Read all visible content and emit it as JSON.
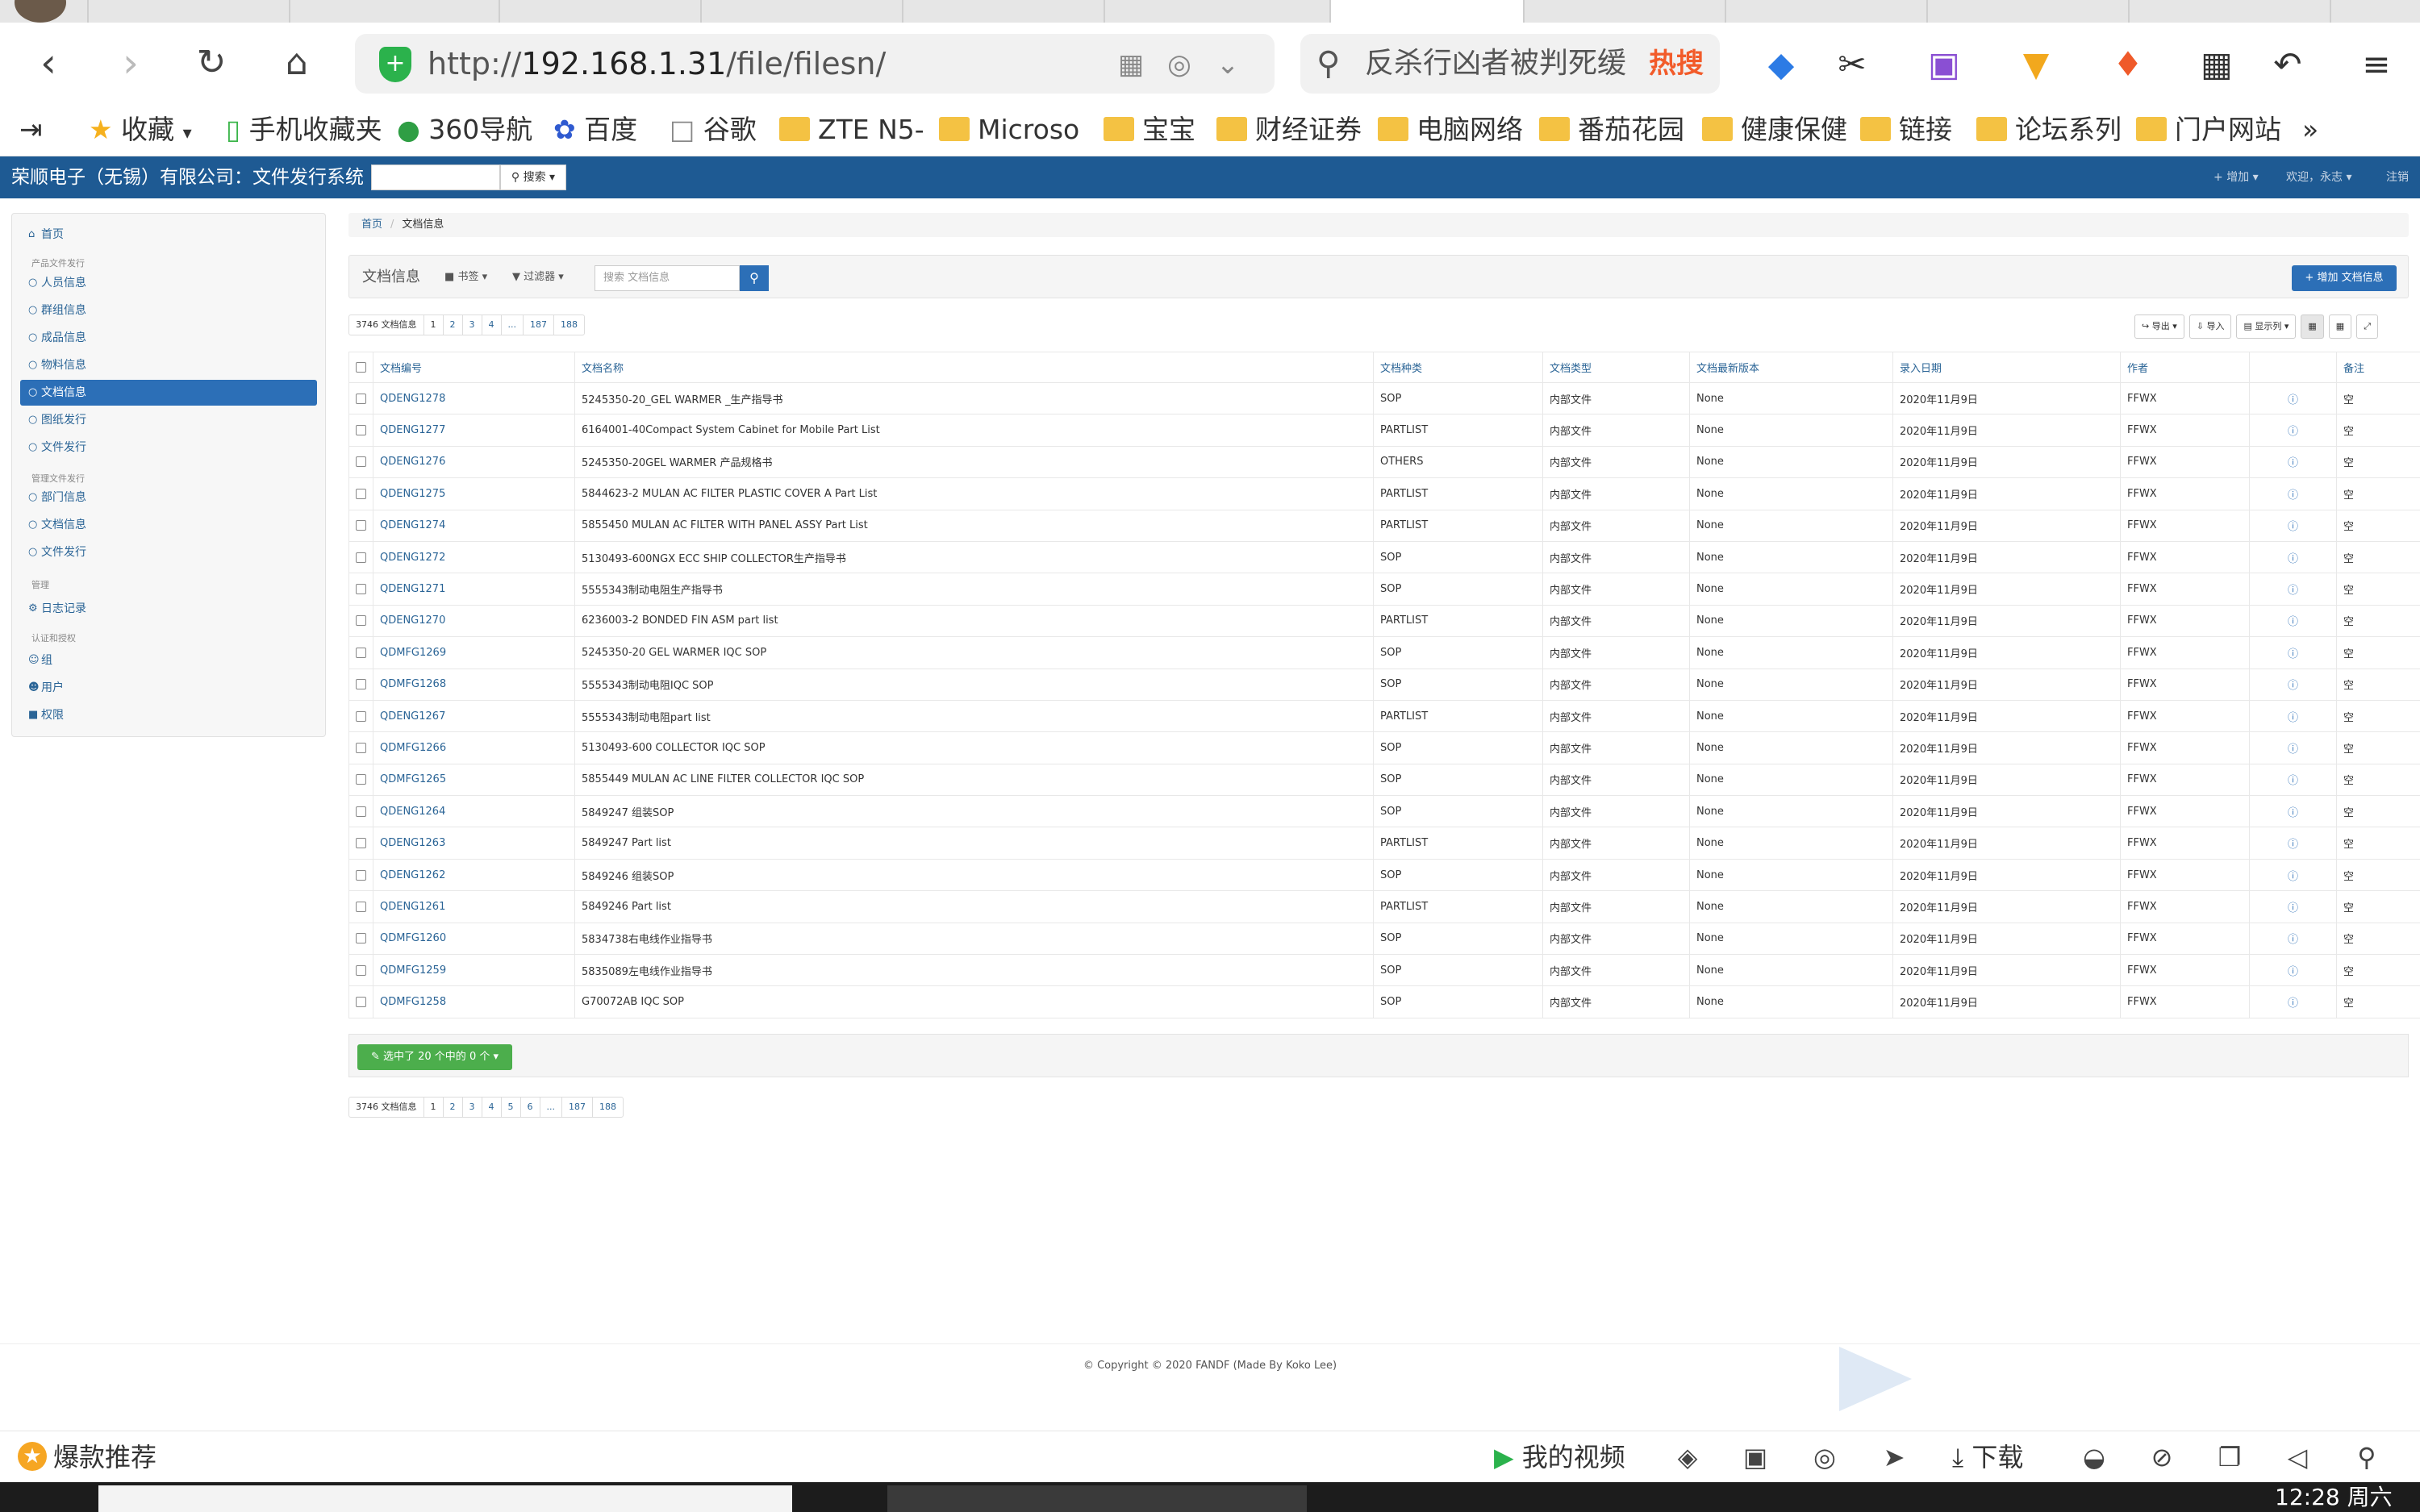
{
  "browser": {
    "url_prefix": "http://",
    "url_host": "192.168.1.31",
    "url_path": "/file/filesn/",
    "search_text": "反杀行凶者被判死缓",
    "search_hot": "热搜",
    "bookmarks": [
      {
        "label": "收藏",
        "icon": "star-icon"
      },
      {
        "label": "手机收藏夹",
        "icon": "phone-icon"
      },
      {
        "label": "360导航",
        "icon": "360-icon"
      },
      {
        "label": "百度",
        "icon": "paw-icon"
      },
      {
        "label": "谷歌",
        "icon": "page-icon"
      },
      {
        "label": "ZTE N5-",
        "icon": "folder-icon"
      },
      {
        "label": "Microso",
        "icon": "folder-icon"
      },
      {
        "label": "宝宝",
        "icon": "folder-icon"
      },
      {
        "label": "财经证券",
        "icon": "folder-icon"
      },
      {
        "label": "电脑网络",
        "icon": "folder-icon"
      },
      {
        "label": "番茄花园",
        "icon": "folder-icon"
      },
      {
        "label": "健康保健",
        "icon": "folder-icon"
      },
      {
        "label": "链接",
        "icon": "folder-icon"
      },
      {
        "label": "论坛系列",
        "icon": "folder-icon"
      },
      {
        "label": "门户网站",
        "icon": "folder-icon"
      }
    ],
    "more": "»"
  },
  "app": {
    "brand": "荣顺电子（无锡）有限公司：文件发行系统",
    "search_button": "搜索",
    "add_menu": "增加",
    "welcome": "欢迎，永志",
    "logout": "注销"
  },
  "sidebar": {
    "home": "首页",
    "group1": "产品文件发行",
    "g1_items": [
      "人员信息",
      "群组信息",
      "成品信息",
      "物料信息",
      "文档信息",
      "图纸发行",
      "文件发行"
    ],
    "group2": "管理文件发行",
    "g2_items": [
      "部门信息",
      "文档信息",
      "文件发行"
    ],
    "group3": "管理",
    "log": "日志记录",
    "group4": "认证和授权",
    "auth_items": [
      "组",
      "用户",
      "权限"
    ]
  },
  "breadcrumb": {
    "home": "首页",
    "current": "文档信息"
  },
  "panel": {
    "title": "文档信息",
    "bookmarks_dd": "书签",
    "filter_dd": "过滤器",
    "search_placeholder": "搜索 文档信息",
    "add_button": "增加 文档信息"
  },
  "pager_top": {
    "count": "3746 文档信息",
    "pages": [
      "1",
      "2",
      "3",
      "4",
      "...",
      "187",
      "188"
    ]
  },
  "pager_bottom": {
    "count": "3746 文档信息",
    "pages": [
      "1",
      "2",
      "3",
      "4",
      "5",
      "6",
      "...",
      "187",
      "188"
    ]
  },
  "table_tools": {
    "export": "导出",
    "import": "导入",
    "columns": "显示列"
  },
  "table": {
    "headers": [
      "文档编号",
      "文档名称",
      "文档种类",
      "文档类型",
      "文档最新版本",
      "录入日期",
      "作者",
      "备注"
    ],
    "rows": [
      [
        "QDENG1278",
        "5245350-20_GEL WARMER _生产指导书",
        "SOP",
        "内部文件",
        "None",
        "2020年11月9日",
        "FFWX",
        "空"
      ],
      [
        "QDENG1277",
        "6164001-40Compact System Cabinet for Mobile Part List",
        "PARTLIST",
        "内部文件",
        "None",
        "2020年11月9日",
        "FFWX",
        "空"
      ],
      [
        "QDENG1276",
        "5245350-20GEL WARMER 产品规格书",
        "OTHERS",
        "内部文件",
        "None",
        "2020年11月9日",
        "FFWX",
        "空"
      ],
      [
        "QDENG1275",
        "5844623-2 MULAN AC FILTER PLASTIC COVER A Part List",
        "PARTLIST",
        "内部文件",
        "None",
        "2020年11月9日",
        "FFWX",
        "空"
      ],
      [
        "QDENG1274",
        "5855450 MULAN AC FILTER WITH PANEL ASSY Part List",
        "PARTLIST",
        "内部文件",
        "None",
        "2020年11月9日",
        "FFWX",
        "空"
      ],
      [
        "QDENG1272",
        "5130493-600NGX ECC SHIP COLLECTOR生产指导书",
        "SOP",
        "内部文件",
        "None",
        "2020年11月9日",
        "FFWX",
        "空"
      ],
      [
        "QDENG1271",
        "5555343制动电阻生产指导书",
        "SOP",
        "内部文件",
        "None",
        "2020年11月9日",
        "FFWX",
        "空"
      ],
      [
        "QDENG1270",
        "6236003-2 BONDED FIN ASM part list",
        "PARTLIST",
        "内部文件",
        "None",
        "2020年11月9日",
        "FFWX",
        "空"
      ],
      [
        "QDMFG1269",
        "5245350-20 GEL WARMER IQC SOP",
        "SOP",
        "内部文件",
        "None",
        "2020年11月9日",
        "FFWX",
        "空"
      ],
      [
        "QDMFG1268",
        "5555343制动电阻IQC SOP",
        "SOP",
        "内部文件",
        "None",
        "2020年11月9日",
        "FFWX",
        "空"
      ],
      [
        "QDENG1267",
        "5555343制动电阻part list",
        "PARTLIST",
        "内部文件",
        "None",
        "2020年11月9日",
        "FFWX",
        "空"
      ],
      [
        "QDMFG1266",
        "5130493-600 COLLECTOR IQC SOP",
        "SOP",
        "内部文件",
        "None",
        "2020年11月9日",
        "FFWX",
        "空"
      ],
      [
        "QDMFG1265",
        "5855449 MULAN AC LINE FILTER COLLECTOR IQC SOP",
        "SOP",
        "内部文件",
        "None",
        "2020年11月9日",
        "FFWX",
        "空"
      ],
      [
        "QDENG1264",
        "5849247 组装SOP",
        "SOP",
        "内部文件",
        "None",
        "2020年11月9日",
        "FFWX",
        "空"
      ],
      [
        "QDENG1263",
        "5849247 Part list",
        "PARTLIST",
        "内部文件",
        "None",
        "2020年11月9日",
        "FFWX",
        "空"
      ],
      [
        "QDENG1262",
        "5849246 组装SOP",
        "SOP",
        "内部文件",
        "None",
        "2020年11月9日",
        "FFWX",
        "空"
      ],
      [
        "QDENG1261",
        "5849246 Part list",
        "PARTLIST",
        "内部文件",
        "None",
        "2020年11月9日",
        "FFWX",
        "空"
      ],
      [
        "QDMFG1260",
        "5834738右电线作业指导书",
        "SOP",
        "内部文件",
        "None",
        "2020年11月9日",
        "FFWX",
        "空"
      ],
      [
        "QDMFG1259",
        "5835089左电线作业指导书",
        "SOP",
        "内部文件",
        "None",
        "2020年11月9日",
        "FFWX",
        "空"
      ],
      [
        "QDMFG1258",
        "G70072AB IQC SOP",
        "SOP",
        "内部文件",
        "None",
        "2020年11月9日",
        "FFWX",
        "空"
      ]
    ]
  },
  "selection": {
    "label": "选中了 20 个中的 0 个"
  },
  "footer": {
    "copyright": "© Copyright © 2020 FANDF (Made By Koko Lee)"
  },
  "statusbar": {
    "recommend": "爆款推荐",
    "video": "我的视频",
    "download": "下载"
  },
  "taskbar": {
    "clock": "12:28 周六"
  },
  "colors": {
    "navbar": "#1e5a93",
    "accent": "#2c6fb7",
    "success": "#4cae4c",
    "link": "#2a6496"
  }
}
